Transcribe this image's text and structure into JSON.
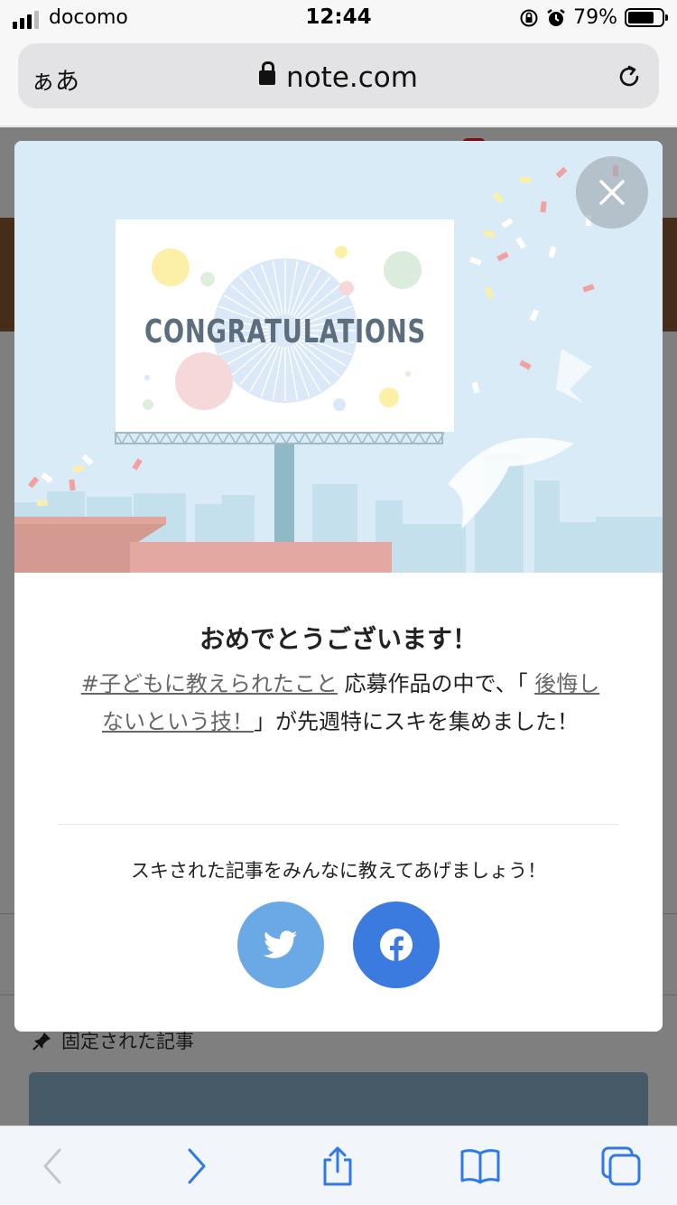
{
  "status_bar": {
    "carrier": "docomo",
    "time": "12:44",
    "battery": "79%",
    "battery_level": 0.79
  },
  "browser": {
    "text_size_button": "ぁあ",
    "domain": "note.com"
  },
  "background_page": {
    "pinned_label": "固定された記事"
  },
  "modal": {
    "hero_sign_text": "CONGRATULATIONS",
    "title": "おめでとうございます！",
    "hashtag_link": "#子どもに教えられたこと",
    "text_part1": "応募作品の中で、「",
    "article_link": "後悔しないという技！",
    "text_part2": "」が先週特にスキを集めました！",
    "share_prompt": "スキされた記事をみんなに教えてあげましょう！",
    "share_twitter_icon": "twitter-icon",
    "share_facebook_icon": "facebook-icon"
  },
  "colors": {
    "hero_bg": "#d9ebf7",
    "twitter": "#6ba8e6",
    "facebook": "#3b7be0",
    "toolbar_icon": "#2f7ae5"
  }
}
